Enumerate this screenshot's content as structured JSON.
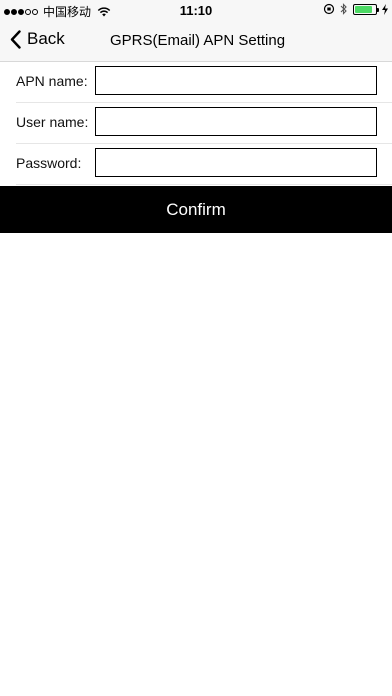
{
  "status_bar": {
    "carrier": "中国移动",
    "time": "11:10",
    "signal_bars_filled": 3,
    "signal_bars_total": 5,
    "battery_level": 0.85,
    "battery_color": "#4cd964"
  },
  "nav": {
    "back_label": "Back",
    "title": "GPRS(Email) APN Setting"
  },
  "form": {
    "fields": [
      {
        "label": "APN name:",
        "value": "",
        "placeholder": ""
      },
      {
        "label": "User name:",
        "value": "",
        "placeholder": ""
      },
      {
        "label": "Password:",
        "value": "",
        "placeholder": ""
      }
    ]
  },
  "confirm_label": "Confirm",
  "colors": {
    "accent": "#000000",
    "background": "#ffffff"
  }
}
